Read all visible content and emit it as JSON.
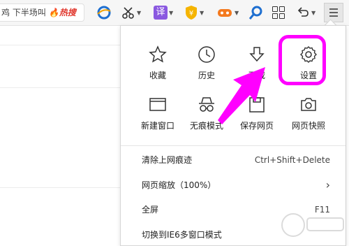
{
  "toolbar": {
    "search_text": "鸡 下半场叫",
    "hot_label": "热搜",
    "translate_label": "译",
    "icons": [
      "ie-icon",
      "scissors-icon",
      "translate-icon",
      "shield-icon",
      "game-icon",
      "search-icon",
      "apps-icon",
      "undo-icon",
      "menu-icon"
    ]
  },
  "menu": {
    "quick": [
      {
        "label": "收藏",
        "icon": "star-icon"
      },
      {
        "label": "历史",
        "icon": "clock-icon"
      },
      {
        "label": "下载",
        "icon": "download-icon"
      },
      {
        "label": "设置",
        "icon": "gear-icon"
      },
      {
        "label": "新建窗口",
        "icon": "window-icon"
      },
      {
        "label": "无痕模式",
        "icon": "incognito-icon"
      },
      {
        "label": "保存网页",
        "icon": "save-icon"
      },
      {
        "label": "网页快照",
        "icon": "camera-icon"
      }
    ],
    "items": [
      {
        "label": "清除上网痕迹",
        "shortcut": "Ctrl+Shift+Delete"
      },
      {
        "label": "网页缩放（100%）",
        "shortcut": "›"
      },
      {
        "label": "全屏",
        "shortcut": "F11"
      },
      {
        "label": "切换到IE6多窗口模式",
        "shortcut": ""
      }
    ]
  },
  "annotation": {
    "color": "#ff00ff"
  }
}
